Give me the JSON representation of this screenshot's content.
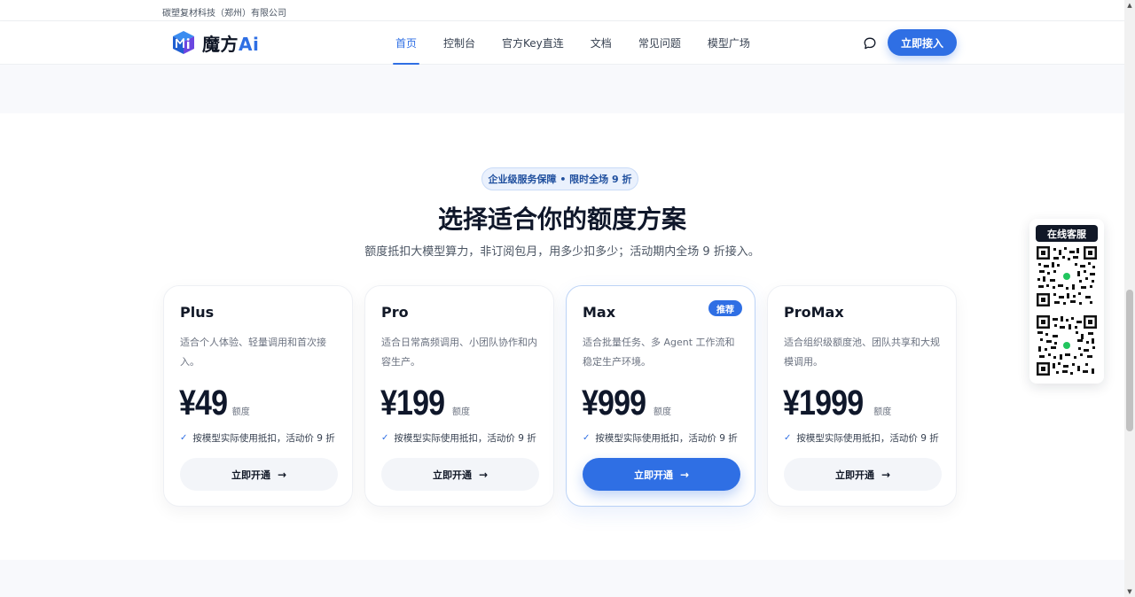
{
  "company": "碳塑复材科技（郑州）有限公司",
  "nav": {
    "logo_text": "魔方",
    "logo_suffix": "Ai",
    "links": [
      "首页",
      "控制台",
      "官方Key直连",
      "文档",
      "常见问题",
      "模型广场"
    ],
    "active_index": 0,
    "cta_label": "立即接入",
    "chat_icon": "chat-bubble-icon"
  },
  "hero": {
    "badge": "企业级服务保障 • 限时全场 9 折",
    "title": "选择适合你的额度方案",
    "subtitle": "额度抵扣大模型算力，非订阅包月，用多少扣多少；活动期内全场 9 折接入。"
  },
  "plans": [
    {
      "name": "Plus",
      "desc": "适合个人体验、轻量调用和首次接入。",
      "price": "¥49",
      "unit": "额度",
      "feature": "按模型实际使用抵扣，活动价 9 折",
      "button": "立即开通",
      "tag": "",
      "featured": false
    },
    {
      "name": "Pro",
      "desc": "适合日常高频调用、小团队协作和内容生产。",
      "price": "¥199",
      "unit": "额度",
      "feature": "按模型实际使用抵扣，活动价 9 折",
      "button": "立即开通",
      "tag": "",
      "featured": false
    },
    {
      "name": "Max",
      "desc": "适合批量任务、多 Agent 工作流和稳定生产环境。",
      "price": "¥999",
      "unit": "额度",
      "feature": "按模型实际使用抵扣，活动价 9 折",
      "button": "立即开通",
      "tag": "推荐",
      "featured": true
    },
    {
      "name": "ProMax",
      "desc": "适合组织级额度池、团队共享和大规模调用。",
      "price": "¥1999",
      "unit": "额度",
      "feature": "按模型实际使用抵扣，活动价 9 折",
      "button": "立即开通",
      "tag": "",
      "featured": false
    }
  ],
  "service": {
    "title": "在线客服"
  },
  "colors": {
    "accent": "#2f6fe4",
    "title": "#0f172a",
    "text_muted": "#6b7280"
  }
}
